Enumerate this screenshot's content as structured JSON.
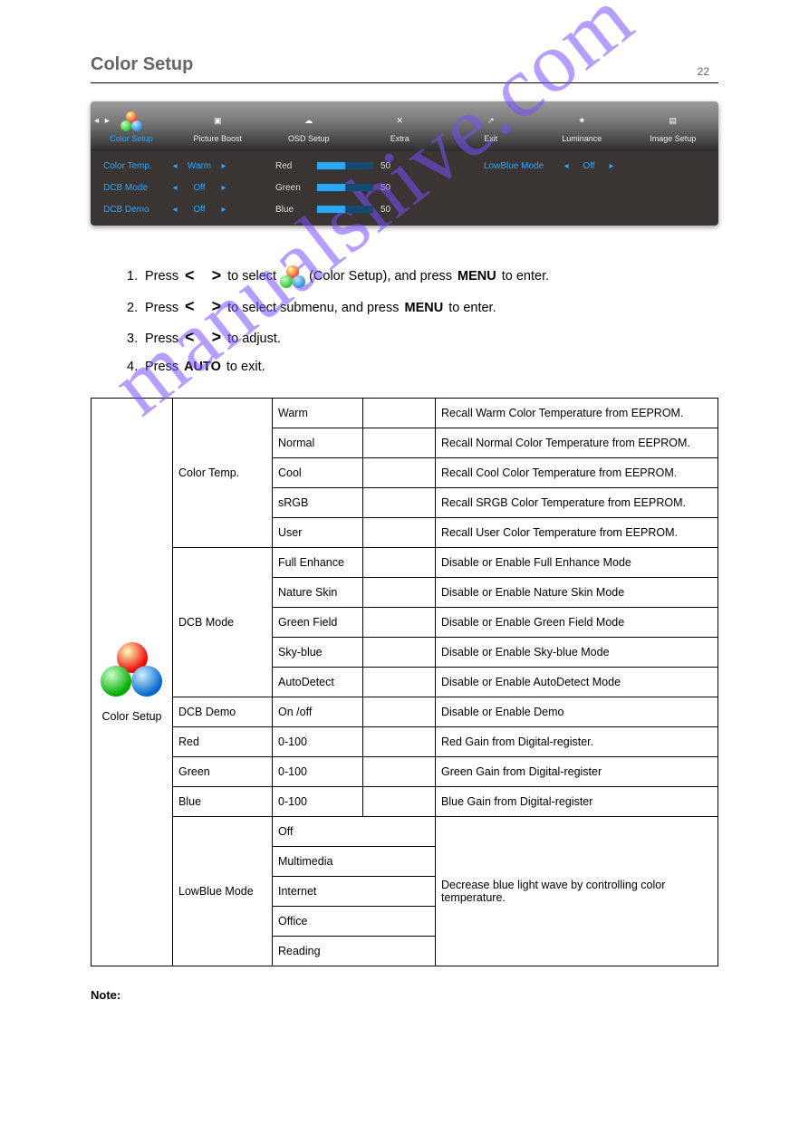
{
  "header": {
    "title": "Color Setup",
    "page_num": "22"
  },
  "osd": {
    "tabs": [
      {
        "key": "color",
        "label": "Color Setup",
        "active": true
      },
      {
        "key": "picture",
        "label": "Picture Boost"
      },
      {
        "key": "osdsetup",
        "label": "OSD Setup"
      },
      {
        "key": "extra",
        "label": "Extra"
      },
      {
        "key": "exit",
        "label": "Exit"
      },
      {
        "key": "luminance",
        "label": "Luminance"
      },
      {
        "key": "image",
        "label": "Image Setup"
      }
    ],
    "left": [
      {
        "label": "Color Temp.",
        "value": "Warm",
        "value_style": "blue"
      },
      {
        "label": "DCB Mode",
        "value": "Off",
        "value_style": "blue"
      },
      {
        "label": "DCB Demo",
        "value": "Off",
        "value_style": "blue"
      }
    ],
    "rgb": [
      {
        "label": "Red",
        "value": "50"
      },
      {
        "label": "Green",
        "value": "50"
      },
      {
        "label": "Blue",
        "value": "50"
      }
    ],
    "right": {
      "label": "LowBlue Mode",
      "value": "Off"
    }
  },
  "steps": {
    "s1a": "Press",
    "s1b": "to select",
    "s1c": "(Color Setup), and press",
    "s1d": "to enter.",
    "s2a": "Press",
    "s2b": "to select submenu, and press",
    "s2c": "to enter.",
    "s3a": "Press",
    "s3b": "to adjust.",
    "s4": "Press",
    "s4b": "to exit.",
    "menu": "MENU",
    "automenu": "AUTO"
  },
  "table": {
    "group_label": "Color Setup",
    "rows_colortemp": [
      {
        "c": "Warm",
        "d": "Recall Warm Color Temperature from EEPROM."
      },
      {
        "c": "Normal",
        "d": "Recall Normal Color Temperature from EEPROM."
      },
      {
        "c": "Cool",
        "d": "Recall Cool Color Temperature from EEPROM."
      },
      {
        "c": "sRGB",
        "d": "Recall SRGB Color Temperature from EEPROM."
      },
      {
        "b": "Color Temp.",
        "c": "User",
        "d": "Recall User Color Temperature from EEPROM."
      }
    ],
    "rows_dcb": [
      {
        "c": "Full Enhance",
        "d": "Disable or Enable Full Enhance Mode"
      },
      {
        "c": "Nature Skin",
        "d": "Disable or Enable Nature Skin Mode"
      },
      {
        "c": "Green Field",
        "d": "Disable or Enable Green Field Mode"
      },
      {
        "c": "Sky-blue",
        "d": "Disable or Enable Sky-blue Mode"
      },
      {
        "b": "DCB Mode",
        "c": "AutoDetect",
        "d": "Disable or Enable AutoDetect Mode"
      }
    ],
    "rows_single": [
      {
        "b": "DCB Demo",
        "c": "On /off",
        "d": "Disable or Enable Demo"
      },
      {
        "b": "Red",
        "c": "0-100",
        "d": "Red Gain from Digital-register."
      },
      {
        "b": "Green",
        "c": "0-100",
        "d": "Green Gain from Digital-register"
      },
      {
        "b": "Blue",
        "c": "0-100",
        "d": "Blue Gain from Digital-register"
      }
    ],
    "rows_lowblue": {
      "b": "LowBlue Mode",
      "items": [
        "Off",
        "Multimedia",
        "Internet",
        "Office",
        "Reading"
      ],
      "d": "Decrease blue light wave by controlling color temperature."
    }
  },
  "note": {
    "label": "Note:",
    "text": ""
  },
  "watermark": "manualshive.com"
}
